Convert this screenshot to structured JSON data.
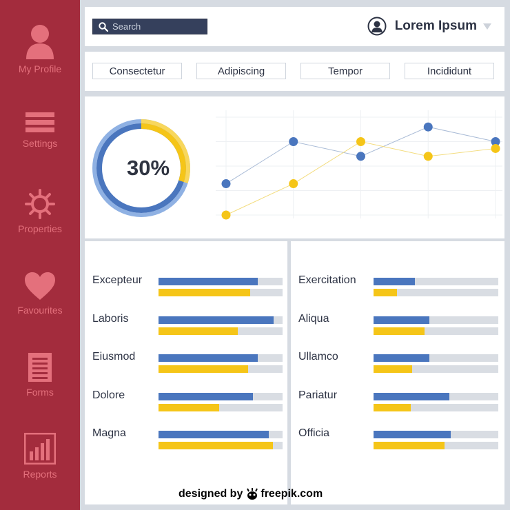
{
  "sidebar": {
    "items": [
      {
        "label": "My Profile",
        "icon": "user-icon"
      },
      {
        "label": "Settings",
        "icon": "menu-icon"
      },
      {
        "label": "Properties",
        "icon": "gear-icon"
      },
      {
        "label": "Favourites",
        "icon": "heart-icon"
      },
      {
        "label": "Forms",
        "icon": "document-icon"
      },
      {
        "label": "Reports",
        "icon": "bar-chart-icon"
      }
    ]
  },
  "header": {
    "search_placeholder": "Search",
    "user_name": "Lorem Ipsum"
  },
  "tabs": [
    "Consectetur",
    "Adipiscing",
    "Tempor",
    "Incididunt"
  ],
  "donut": {
    "percent": 30,
    "label": "30%"
  },
  "chart_data": {
    "type": "line",
    "x": [
      1,
      2,
      3,
      4,
      5
    ],
    "ylim": [
      0,
      1
    ],
    "grid": true,
    "series": [
      {
        "color": "#4a76be",
        "values": [
          0.32,
          0.75,
          0.6,
          0.9,
          0.75
        ]
      },
      {
        "color": "#f5c518",
        "values": [
          0.0,
          0.32,
          0.75,
          0.6,
          0.68
        ]
      }
    ]
  },
  "bars_left": [
    {
      "label": "Excepteur",
      "blue": 0.8,
      "yellow": 0.74
    },
    {
      "label": "Laboris",
      "blue": 0.93,
      "yellow": 0.64
    },
    {
      "label": "Eiusmod",
      "blue": 0.8,
      "yellow": 0.72
    },
    {
      "label": "Dolore",
      "blue": 0.76,
      "yellow": 0.49
    },
    {
      "label": "Magna",
      "blue": 0.89,
      "yellow": 0.92
    }
  ],
  "bars_right": [
    {
      "label": "Exercitation",
      "blue": 0.33,
      "yellow": 0.19
    },
    {
      "label": "Aliqua",
      "blue": 0.45,
      "yellow": 0.41
    },
    {
      "label": "Ullamco",
      "blue": 0.45,
      "yellow": 0.31
    },
    {
      "label": "Pariatur",
      "blue": 0.61,
      "yellow": 0.3
    },
    {
      "label": "Officia",
      "blue": 0.62,
      "yellow": 0.57
    }
  ],
  "colors": {
    "sidebar": "#a32c3d",
    "sidebar_icon": "#e4707c",
    "blue": "#4a76be",
    "yellow": "#f5c518",
    "track": "#d9dde3",
    "search_bg": "#35405c"
  },
  "watermark": {
    "prefix": "designed by",
    "brand": "freepik.com"
  }
}
